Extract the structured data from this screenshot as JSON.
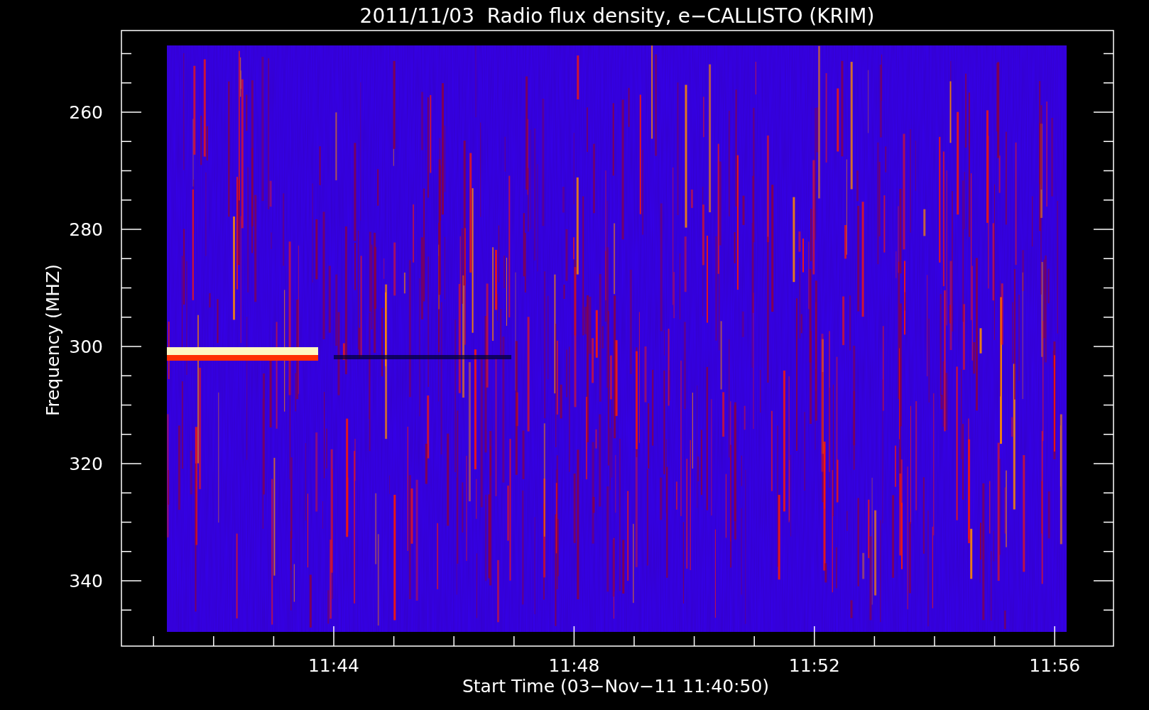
{
  "title": "2011/11/03  Radio flux density, e−CALLISTO (KRIM)",
  "y_axis": {
    "label": "Frequency (MHZ)",
    "ticks": [
      "260",
      "280",
      "300",
      "320",
      "340"
    ]
  },
  "x_axis": {
    "label": "Start Time (03−Nov−11 11:40:50)",
    "ticks": [
      "11:44",
      "11:48",
      "11:52",
      "11:56"
    ]
  }
}
